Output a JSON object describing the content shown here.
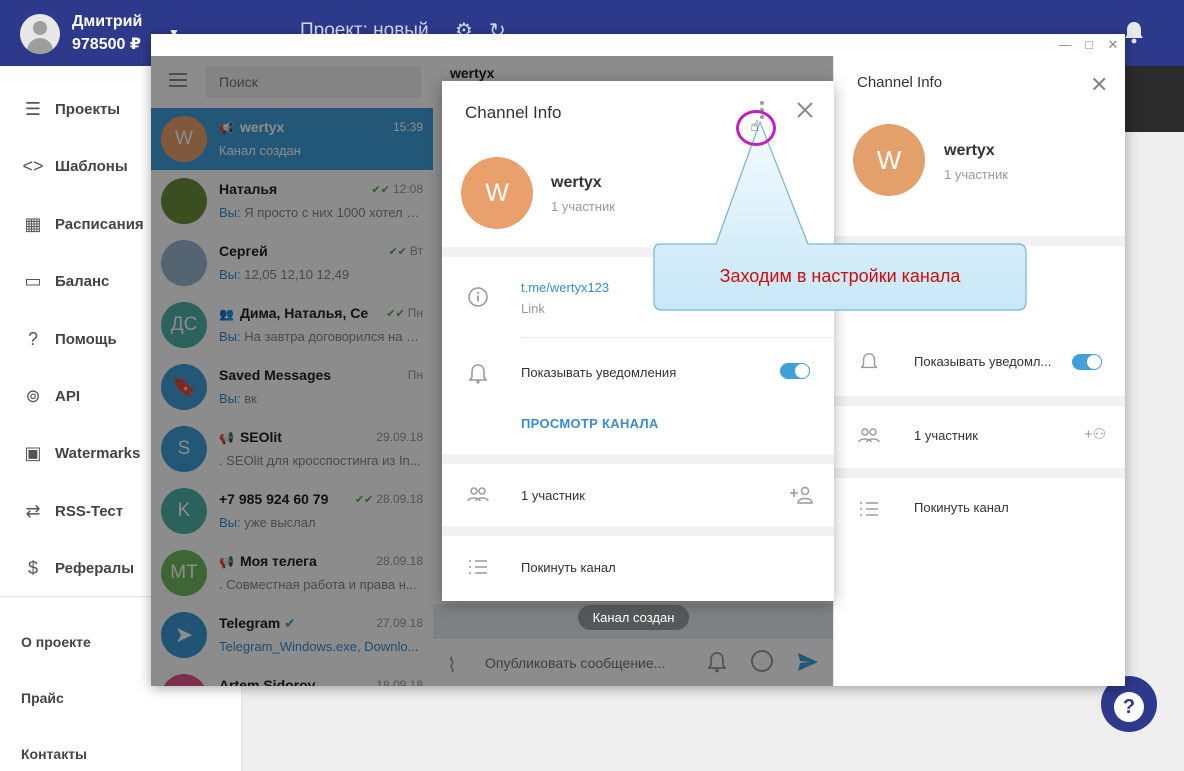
{
  "topbar": {
    "user_name": "Дмитрий",
    "user_balance": "978500 ₽",
    "project_title": "Проект: новый"
  },
  "sidebar": {
    "items": [
      {
        "label": "Проекты",
        "icon": "list-icon"
      },
      {
        "label": "Шаблоны",
        "icon": "code-icon"
      },
      {
        "label": "Расписания",
        "icon": "calendar-icon"
      },
      {
        "label": "Баланс",
        "icon": "card-icon"
      },
      {
        "label": "Помощь",
        "icon": "help-icon"
      },
      {
        "label": "API",
        "icon": "broadcast-icon"
      },
      {
        "label": "Watermarks",
        "icon": "watermark-icon"
      },
      {
        "label": "RSS-Тест",
        "icon": "rss-icon"
      },
      {
        "label": "Рефералы",
        "icon": "dollar-icon"
      }
    ],
    "footer_links": [
      "О проекте",
      "Прайс",
      "Контакты"
    ]
  },
  "chatlist": {
    "search_placeholder": "Поиск",
    "chats": [
      {
        "name": "wertyx",
        "time": "15:39",
        "preview": "Канал создан",
        "avatar": "W",
        "avatar_color": "#e9a06d",
        "channel": true,
        "active": true
      },
      {
        "name": "Наталья",
        "time": "12:08",
        "you": "Вы: ",
        "preview": "Я просто с них 1000 хотел в...",
        "avatar": "",
        "avatar_color": "#6b8e3a",
        "ticks": true
      },
      {
        "name": "Сергей",
        "time": "Вт",
        "you": "Вы: ",
        "preview": "12,05   12,10   12,49",
        "avatar": "",
        "avatar_color": "#9ab7d0",
        "ticks": true
      },
      {
        "name": "Дима, Наталья, Сер...",
        "time": "Пн",
        "you": "Вы: ",
        "preview": "На завтра договорился на с...",
        "avatar": "ДС",
        "avatar_color": "#4fb3a8",
        "ticks": true,
        "group": true
      },
      {
        "name": "Saved Messages",
        "time": "Пн",
        "you": "Вы: ",
        "preview": "вк",
        "avatar": "",
        "avatar_color": "#419fd9",
        "saved": true
      },
      {
        "name": "SEOlit",
        "time": "29.09.18",
        "preview": ". SEOlit для кросспостинга из In...",
        "avatar": "S",
        "avatar_color": "#419fd9",
        "channel": true
      },
      {
        "name": "+7 985 924 60 79",
        "time": "28.09.18",
        "you": "Вы: ",
        "preview": "уже выслал",
        "avatar": "K",
        "avatar_color": "#4fb3a8",
        "ticks": true
      },
      {
        "name": "Моя телега",
        "time": "28.09.18",
        "preview": ". Совместная работа и права н...",
        "avatar": "МТ",
        "avatar_color": "#6dbb5f",
        "channel": true
      },
      {
        "name": "Telegram",
        "time": "27.09.18",
        "preview": "Telegram_Windows.exe, Downlo...",
        "avatar": "",
        "avatar_color": "#3a9ad9",
        "verified": true,
        "preview_link": true
      },
      {
        "name": "Artem Sidorov",
        "time": "18.09.18",
        "preview": "",
        "avatar": "",
        "avatar_color": "#e05a8a"
      }
    ]
  },
  "chat": {
    "title": "wertyx",
    "composer_placeholder": "Опубликовать сообщение...",
    "created_badge": "Канал создан"
  },
  "info_panel": {
    "title": "Channel Info",
    "avatar_letter": "W",
    "name": "wertyx",
    "members": "1 участник",
    "notifications": "Показывать уведомл...",
    "participants": "1 участник",
    "leave": "Покинуть канал"
  },
  "modal": {
    "title": "Channel Info",
    "avatar_letter": "W",
    "name": "wertyx",
    "members": "1 участник",
    "link": "t.me/wertyx123",
    "link_caption": "Link",
    "notifications": "Показывать уведомления",
    "notifications_on": true,
    "view_channel": "ПРОСМОТР КАНАЛА",
    "participants": "1 участник",
    "leave": "Покинуть канал"
  },
  "callout": {
    "text": "Заходим в настройки канала"
  },
  "colors": {
    "topbar": "#2d3a8c",
    "accent": "#419fd9",
    "callout_text": "#d10a0a",
    "cursor_ring": "#c020c0"
  }
}
